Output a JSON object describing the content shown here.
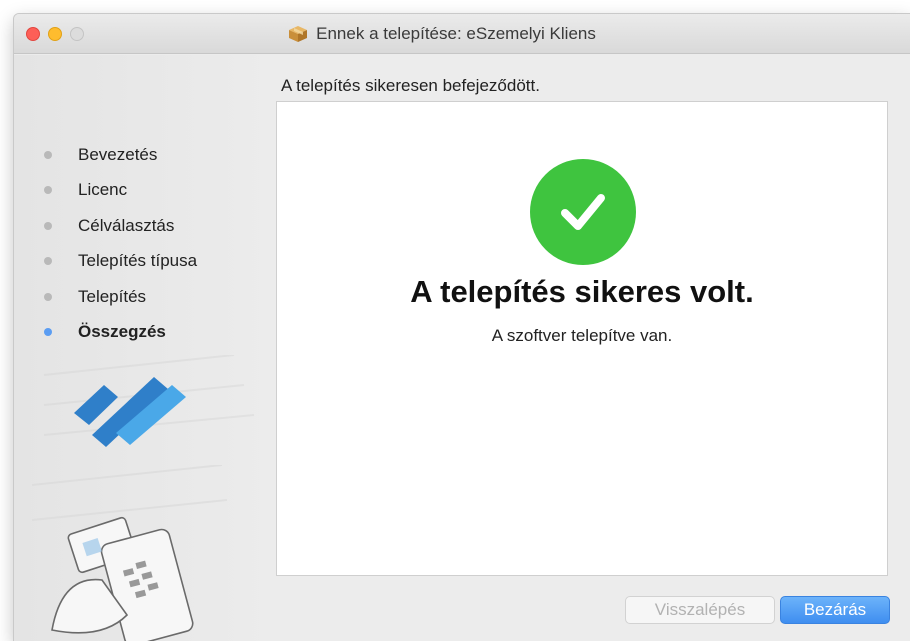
{
  "window": {
    "title": "Ennek a telepítése: eSzemelyi Kliens"
  },
  "sidebar": {
    "steps": [
      {
        "label": "Bevezetés",
        "active": false
      },
      {
        "label": "Licenc",
        "active": false
      },
      {
        "label": "Célválasztás",
        "active": false
      },
      {
        "label": "Telepítés típusa",
        "active": false
      },
      {
        "label": "Telepítés",
        "active": false
      },
      {
        "label": "Összegzés",
        "active": true
      }
    ]
  },
  "main": {
    "heading": "A telepítés sikeresen befejeződött.",
    "success_title": "A telepítés sikeres volt.",
    "success_subtitle": "A szoftver telepítve van."
  },
  "buttons": {
    "back_label": "Visszalépés",
    "back_enabled": false,
    "close_label": "Bezárás"
  },
  "colors": {
    "accent": "#3f8ef0",
    "success": "#3fc43f",
    "active_bullet": "#5b9df2",
    "inactive_bullet": "#b9b9b9"
  },
  "icons": [
    "package-icon",
    "checkmark-icon",
    "eszemelyi-logo",
    "id-card-device-illustration"
  ]
}
